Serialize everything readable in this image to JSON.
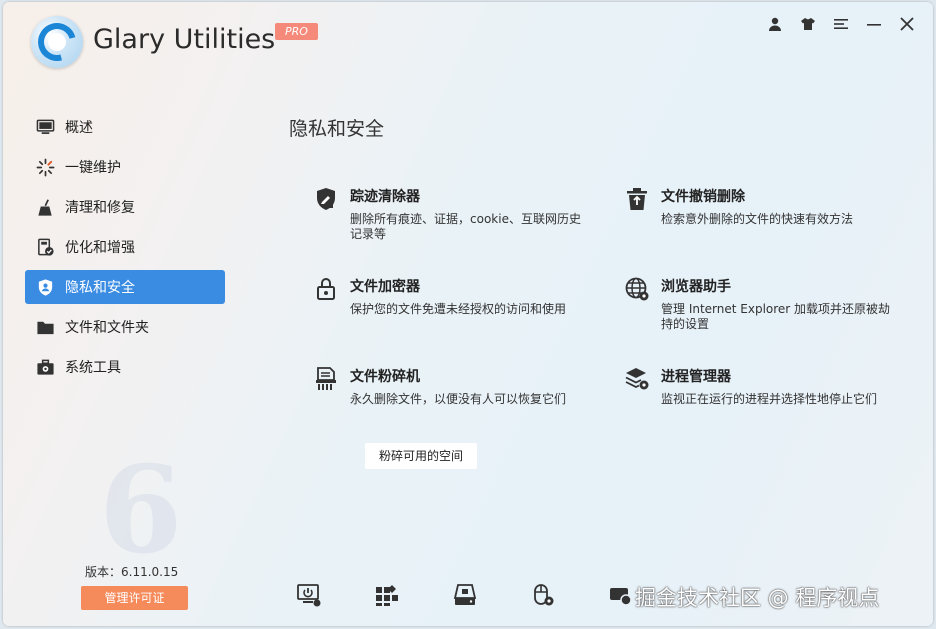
{
  "app": {
    "title": "Glary Utilities",
    "badge": "PRO"
  },
  "sidebar": {
    "items": [
      {
        "label": "概述",
        "icon": "monitor-icon",
        "active": false
      },
      {
        "label": "一键维护",
        "icon": "sparkle-icon",
        "active": false
      },
      {
        "label": "清理和修复",
        "icon": "broom-icon",
        "active": false
      },
      {
        "label": "优化和增强",
        "icon": "optimize-icon",
        "active": false
      },
      {
        "label": "隐私和安全",
        "icon": "shield-icon",
        "active": true
      },
      {
        "label": "文件和文件夹",
        "icon": "folder-icon",
        "active": false
      },
      {
        "label": "系统工具",
        "icon": "toolbox-icon",
        "active": false
      }
    ],
    "version_label": "版本：",
    "version_value": "6.11.0.15",
    "license_button": "管理许可证"
  },
  "main": {
    "title": "隐私和安全",
    "tools": [
      {
        "name": "踪迹清除器",
        "desc": "删除所有痕迹、证据，cookie、互联网历史记录等",
        "icon": "tracks-eraser-icon"
      },
      {
        "name": "文件撤销删除",
        "desc": "检索意外删除的文件的快速有效方法",
        "icon": "file-undelete-icon"
      },
      {
        "name": "文件加密器",
        "desc": "保护您的文件免遭未经授权的访问和使用",
        "icon": "file-encrypt-icon"
      },
      {
        "name": "浏览器助手",
        "desc": "管理 Internet Explorer 加载项并还原被劫持的设置",
        "icon": "browser-globe-icon"
      },
      {
        "name": "文件粉碎机",
        "desc": "永久删除文件，以便没有人可以恢复它们",
        "icon": "file-shredder-icon"
      },
      {
        "name": "进程管理器",
        "desc": "监视正在运行的进程并选择性地停止它们",
        "icon": "process-manager-icon"
      }
    ],
    "shred_free_space_button": "粉碎可用的空间"
  },
  "watermark": "掘金技术社区 @ 程序视点",
  "colors": {
    "accent": "#3a8ce3",
    "license": "#f58a5a",
    "badge": "#f58a7a"
  }
}
